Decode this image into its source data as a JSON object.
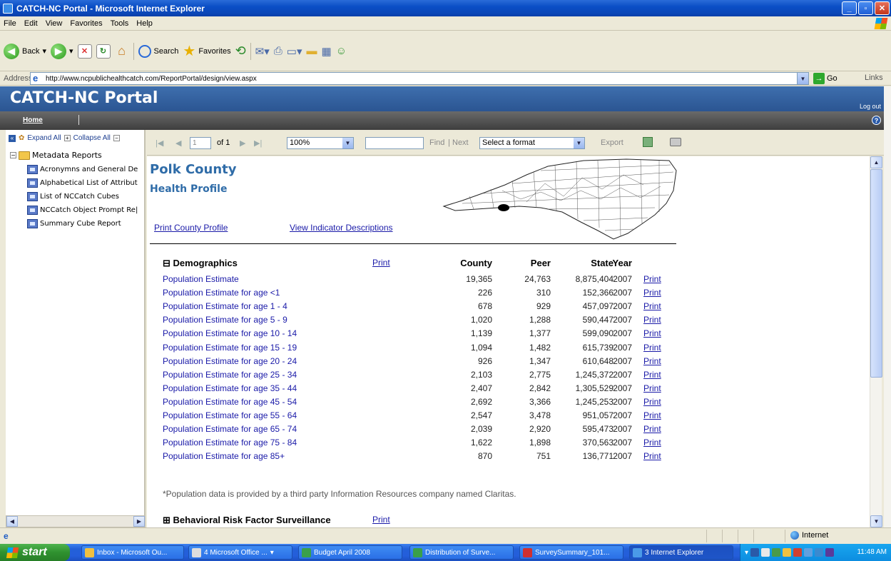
{
  "window": {
    "title": "CATCH-NC Portal - Microsoft Internet Explorer"
  },
  "menu": [
    "File",
    "Edit",
    "View",
    "Favorites",
    "Tools",
    "Help"
  ],
  "toolbar": {
    "back": "Back",
    "search": "Search",
    "favorites": "Favorites"
  },
  "address": {
    "label": "Address",
    "url": "http://www.ncpublichealthcatch.com/ReportPortal/design/view.aspx",
    "go": "Go",
    "links": "Links"
  },
  "portal": {
    "title": "CATCH-NC Portal",
    "nav_home": "Home",
    "logout": "Log out"
  },
  "tree": {
    "expand_all": "Expand All",
    "collapse_all": "Collapse All",
    "root": "Metadata Reports",
    "items": [
      "Acronymns and General De",
      "Alphabetical List of Attribut",
      "List of NCCatch Cubes",
      "NCCatch Object Prompt Re|",
      "Summary Cube Report"
    ]
  },
  "report_toolbar": {
    "page_value": "1",
    "of_pages": "of 1",
    "zoom": "100%",
    "find": "Find",
    "next": "Next",
    "format": "Select a format",
    "export": "Export"
  },
  "report": {
    "county": "Polk County",
    "subtitle": "Health Profile",
    "print_profile": "Print County Profile",
    "view_descriptions": "View Indicator Descriptions",
    "demographics": {
      "title": "Demographics",
      "print": "Print",
      "headers": {
        "county": "County",
        "peer": "Peer",
        "state": "State",
        "year": "Year"
      },
      "rows": [
        {
          "label": "Population Estimate",
          "county": "19,365",
          "peer": "24,763",
          "state": "8,875,404",
          "year": "2007",
          "print": "Print"
        },
        {
          "label": "Population Estimate for age <1",
          "county": "226",
          "peer": "310",
          "state": "152,366",
          "year": "2007",
          "print": "Print"
        },
        {
          "label": "Population Estimate for age 1 - 4",
          "county": "678",
          "peer": "929",
          "state": "457,097",
          "year": "2007",
          "print": "Print"
        },
        {
          "label": "Population Estimate for age 5 - 9",
          "county": "1,020",
          "peer": "1,288",
          "state": "590,447",
          "year": "2007",
          "print": "Print"
        },
        {
          "label": "Population Estimate for age 10 - 14",
          "county": "1,139",
          "peer": "1,377",
          "state": "599,090",
          "year": "2007",
          "print": "Print"
        },
        {
          "label": "Population Estimate for age 15 - 19",
          "county": "1,094",
          "peer": "1,482",
          "state": "615,739",
          "year": "2007",
          "print": "Print"
        },
        {
          "label": "Population Estimate for age 20 - 24",
          "county": "926",
          "peer": "1,347",
          "state": "610,648",
          "year": "2007",
          "print": "Print"
        },
        {
          "label": "Population Estimate for age 25 - 34",
          "county": "2,103",
          "peer": "2,775",
          "state": "1,245,372",
          "year": "2007",
          "print": "Print"
        },
        {
          "label": "Population Estimate for age 35 - 44",
          "county": "2,407",
          "peer": "2,842",
          "state": "1,305,529",
          "year": "2007",
          "print": "Print"
        },
        {
          "label": "Population Estimate for age 45 - 54",
          "county": "2,692",
          "peer": "3,366",
          "state": "1,245,253",
          "year": "2007",
          "print": "Print"
        },
        {
          "label": "Population Estimate for age 55 - 64",
          "county": "2,547",
          "peer": "3,478",
          "state": "951,057",
          "year": "2007",
          "print": "Print"
        },
        {
          "label": "Population Estimate for age 65 - 74",
          "county": "2,039",
          "peer": "2,920",
          "state": "595,473",
          "year": "2007",
          "print": "Print"
        },
        {
          "label": "Population Estimate for age 75 - 84",
          "county": "1,622",
          "peer": "1,898",
          "state": "370,563",
          "year": "2007",
          "print": "Print"
        },
        {
          "label": "Population Estimate for age 85+",
          "county": "870",
          "peer": "751",
          "state": "136,771",
          "year": "2007",
          "print": "Print"
        }
      ],
      "footnote": "*Population data is provided by a third party Information Resources company named Claritas."
    },
    "next_section": {
      "title": "Behavioral Risk Factor Surveillance",
      "print": "Print"
    }
  },
  "status": {
    "zone": "Internet"
  },
  "taskbar": {
    "start": "start",
    "tasks": [
      "Inbox - Microsoft Ou...",
      "4 Microsoft Office ...",
      "Budget April 2008",
      "Distribution of Surve...",
      "SurveySummary_101...",
      "3 Internet Explorer"
    ],
    "clock": "11:48 AM"
  }
}
